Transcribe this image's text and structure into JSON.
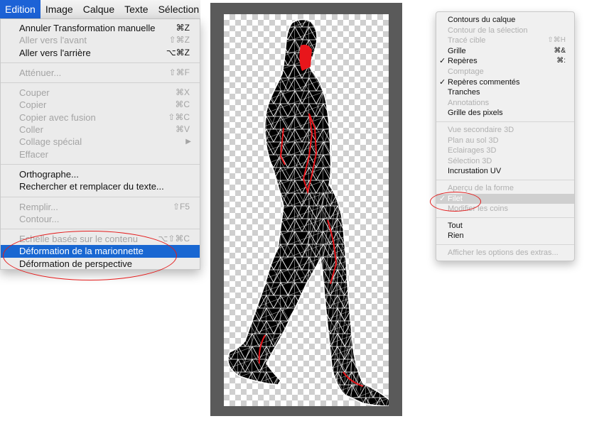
{
  "menubar": {
    "titles": [
      "Edition",
      "Image",
      "Calque",
      "Texte",
      "Sélection"
    ]
  },
  "edit_menu": {
    "g1": [
      {
        "label": "Annuler Transformation manuelle",
        "shortcut": "⌘Z"
      },
      {
        "label": "Aller vers l'avant",
        "shortcut": "⇧⌘Z"
      },
      {
        "label": "Aller vers l'arrière",
        "shortcut": "⌥⌘Z"
      }
    ],
    "g2": [
      {
        "label": "Atténuer...",
        "shortcut": "⇧⌘F"
      }
    ],
    "g3": [
      {
        "label": "Couper",
        "shortcut": "⌘X"
      },
      {
        "label": "Copier",
        "shortcut": "⌘C"
      },
      {
        "label": "Copier avec fusion",
        "shortcut": "⇧⌘C"
      },
      {
        "label": "Coller",
        "shortcut": "⌘V"
      },
      {
        "label": "Collage spécial",
        "shortcut": "▶"
      },
      {
        "label": "Effacer",
        "shortcut": ""
      }
    ],
    "g4": [
      {
        "label": "Orthographe...",
        "shortcut": ""
      },
      {
        "label": "Rechercher et remplacer du texte...",
        "shortcut": ""
      }
    ],
    "g5": [
      {
        "label": "Remplir...",
        "shortcut": "⇧F5"
      },
      {
        "label": "Contour...",
        "shortcut": ""
      }
    ],
    "g6": [
      {
        "label": "Echelle basée sur le contenu",
        "shortcut": "⌥⇧⌘C"
      },
      {
        "label": "Déformation de la marionnette",
        "shortcut": ""
      },
      {
        "label": "Déformation de perspective",
        "shortcut": ""
      }
    ]
  },
  "extras_menu": {
    "g1": [
      {
        "label": "Contours du calque",
        "shortcut": "",
        "check": ""
      },
      {
        "label": "Contour de la sélection",
        "shortcut": "",
        "check": ""
      },
      {
        "label": "Tracé cible",
        "shortcut": "⇧⌘H",
        "check": ""
      },
      {
        "label": "Grille",
        "shortcut": "⌘&",
        "check": ""
      },
      {
        "label": "Repères",
        "shortcut": "⌘:",
        "check": "✓"
      },
      {
        "label": "Comptage",
        "shortcut": "",
        "check": ""
      },
      {
        "label": "Repères commentés",
        "shortcut": "",
        "check": "✓"
      },
      {
        "label": "Tranches",
        "shortcut": "",
        "check": ""
      },
      {
        "label": "Annotations",
        "shortcut": "",
        "check": ""
      },
      {
        "label": "Grille des pixels",
        "shortcut": "",
        "check": ""
      }
    ],
    "g2": [
      {
        "label": "Vue secondaire 3D",
        "shortcut": "",
        "check": ""
      },
      {
        "label": "Plan au sol 3D",
        "shortcut": "",
        "check": ""
      },
      {
        "label": "Eclairages 3D",
        "shortcut": "",
        "check": ""
      },
      {
        "label": "Sélection 3D",
        "shortcut": "",
        "check": ""
      },
      {
        "label": "Incrustation UV",
        "shortcut": "",
        "check": ""
      }
    ],
    "g3": [
      {
        "label": "Aperçu de la forme",
        "shortcut": "",
        "check": ""
      },
      {
        "label": "Filet",
        "shortcut": "",
        "check": "✓"
      },
      {
        "label": "Modifier les coins",
        "shortcut": "",
        "check": ""
      }
    ],
    "g4": [
      {
        "label": "Tout",
        "shortcut": "",
        "check": ""
      },
      {
        "label": "Rien",
        "shortcut": "",
        "check": ""
      }
    ],
    "g5": [
      {
        "label": "Afficher les options des extras...",
        "shortcut": "",
        "check": ""
      }
    ]
  },
  "colors": {
    "highlight": "#1967d2",
    "annotation": "#e41b1b",
    "mesh_pin": "#e8161b",
    "figure": "#000000",
    "mesh": "#ffffff"
  }
}
